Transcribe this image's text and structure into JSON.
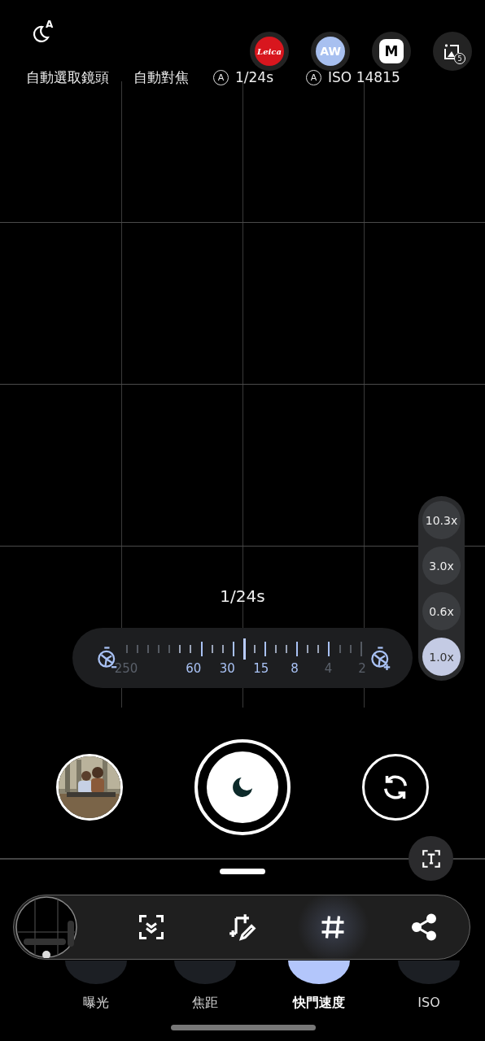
{
  "night_mode": {
    "badge": "A"
  },
  "quick_badges": [
    {
      "kind": "leica",
      "text": "Leica"
    },
    {
      "kind": "aw",
      "text": "AW"
    },
    {
      "kind": "m",
      "text": "M"
    },
    {
      "kind": "frames",
      "text": "5"
    }
  ],
  "settings": [
    {
      "kind": "plain",
      "label": "自動選取鏡頭"
    },
    {
      "kind": "plain",
      "label": "自動對焦"
    },
    {
      "kind": "auto",
      "badge": "A",
      "label": "1/24s"
    },
    {
      "kind": "auto",
      "badge": "A",
      "label": "ISO 14815"
    }
  ],
  "shutter_reading": "1/24s",
  "dial": {
    "level": 0.5,
    "labels": [
      {
        "text": "250",
        "dim": true
      },
      {
        "text": "60",
        "dim": false
      },
      {
        "text": "30",
        "dim": false
      },
      {
        "text": "15",
        "dim": false
      },
      {
        "text": "8",
        "dim": false
      },
      {
        "text": "4",
        "dim": true
      },
      {
        "text": "2",
        "dim": true
      }
    ]
  },
  "zoom": [
    {
      "label": "10.3x",
      "selected": false
    },
    {
      "label": "3.0x",
      "selected": false
    },
    {
      "label": "0.6x",
      "selected": false
    },
    {
      "label": "1.0x",
      "selected": true
    }
  ],
  "toolbar": [
    {
      "kind": "preview",
      "selected": false
    },
    {
      "kind": "scan",
      "selected": false
    },
    {
      "kind": "crop_edit",
      "selected": false
    },
    {
      "kind": "grid",
      "selected": true
    },
    {
      "kind": "share",
      "selected": false
    }
  ],
  "modes": [
    {
      "label": "曝光",
      "selected": false
    },
    {
      "label": "焦距",
      "selected": false
    },
    {
      "label": "快門速度",
      "selected": true
    },
    {
      "label": "ISO",
      "selected": false
    }
  ]
}
